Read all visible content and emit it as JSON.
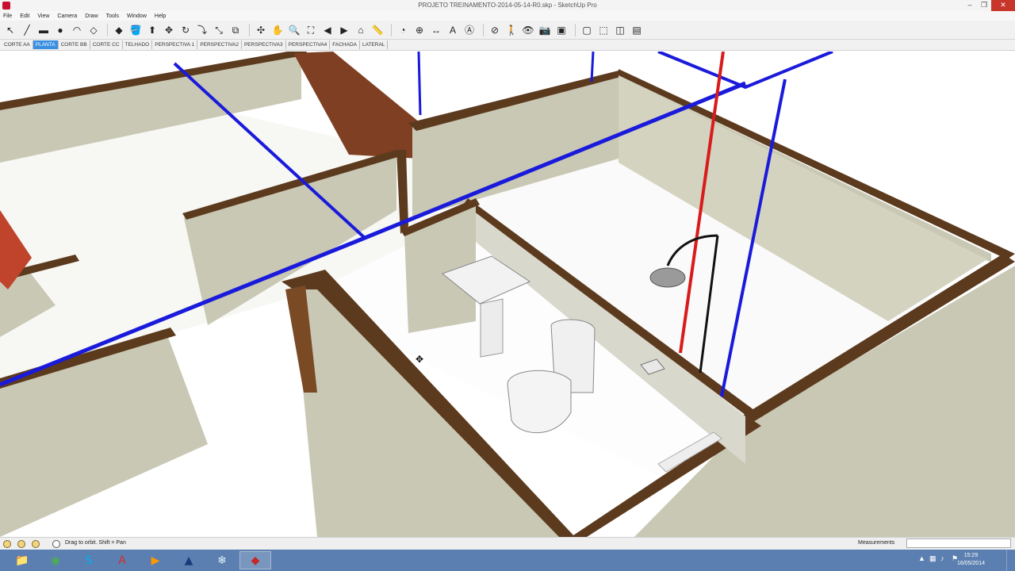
{
  "window": {
    "title": "PROJETO TREINAMENTO-2014-05-14-R0.skp - SketchUp Pro",
    "minimize": "–",
    "maximize": "❐",
    "close": "✕"
  },
  "menu": [
    "File",
    "Edit",
    "View",
    "Camera",
    "Draw",
    "Tools",
    "Window",
    "Help"
  ],
  "toolbar": {
    "icons": [
      "select-icon",
      "pencil-icon",
      "rectangle-icon",
      "circle-icon",
      "arc-icon",
      "make-component-icon",
      "eraser-icon",
      "paint-bucket-icon",
      "push-pull-icon",
      "move-icon",
      "rotate-icon",
      "follow-me-icon",
      "scale-icon",
      "offset-icon",
      "orbit-icon",
      "pan-icon",
      "zoom-icon",
      "zoom-extents-icon",
      "previous-view-icon",
      "next-view-icon",
      "standard-views-icon",
      "tape-measure-icon",
      "protractor-icon",
      "axes-icon",
      "dimension-icon",
      "text-icon",
      "3d-text-icon",
      "section-plane-icon",
      "walk-icon",
      "look-around-icon",
      "position-camera-icon",
      "x-ray-icon",
      "back-edges-icon",
      "wireframe-icon",
      "hidden-line-icon",
      "shaded-icon"
    ],
    "glyphs": [
      "↖",
      "╱",
      "▬",
      "●",
      "◠",
      "◇",
      "◆",
      "🪣",
      "⬆",
      "✥",
      "↻",
      "⤵",
      "⤡",
      "⧉",
      "✣",
      "✋",
      "🔍",
      "⛶",
      "◀",
      "▶",
      "⌂",
      "📏",
      "◔",
      "⊕",
      "↔",
      "A",
      "Ⓐ",
      "⊘",
      "🚶",
      "👁",
      "📷",
      "▣",
      "▢",
      "⬚",
      "◫",
      "▤"
    ]
  },
  "scenes": {
    "active_index": 1,
    "tabs": [
      "CORTE AA",
      "PLANTA",
      "CORTE BB",
      "CORTE CC",
      "TELHADO",
      "PERSPECTIVA 1",
      "PERSPECTIVA2",
      "PERSPECTIVA3",
      "PERSPECTIVA4",
      "FACHADA",
      "LATERAL"
    ]
  },
  "status": {
    "hint": "Drag to orbit.  Shift = Pan",
    "measurements_label": "Measurements",
    "measurements_value": ""
  },
  "taskbar": {
    "apps": [
      "file-explorer-icon",
      "chrome-icon",
      "skype-icon",
      "acrobat-icon",
      "media-player-icon",
      "autocad-icon",
      "snowflake-app-icon",
      "sketchup-icon"
    ],
    "clock_time": "15:29",
    "clock_date": "16/05/2014"
  },
  "colors": {
    "wall_top": "#5c3a1e",
    "wall_face": "#c9c8b4",
    "floor": "#f4f4f0",
    "pipe_cold": "#1a1adb",
    "pipe_hot": "#d81b1b",
    "door_panel": "#7e3f22"
  }
}
